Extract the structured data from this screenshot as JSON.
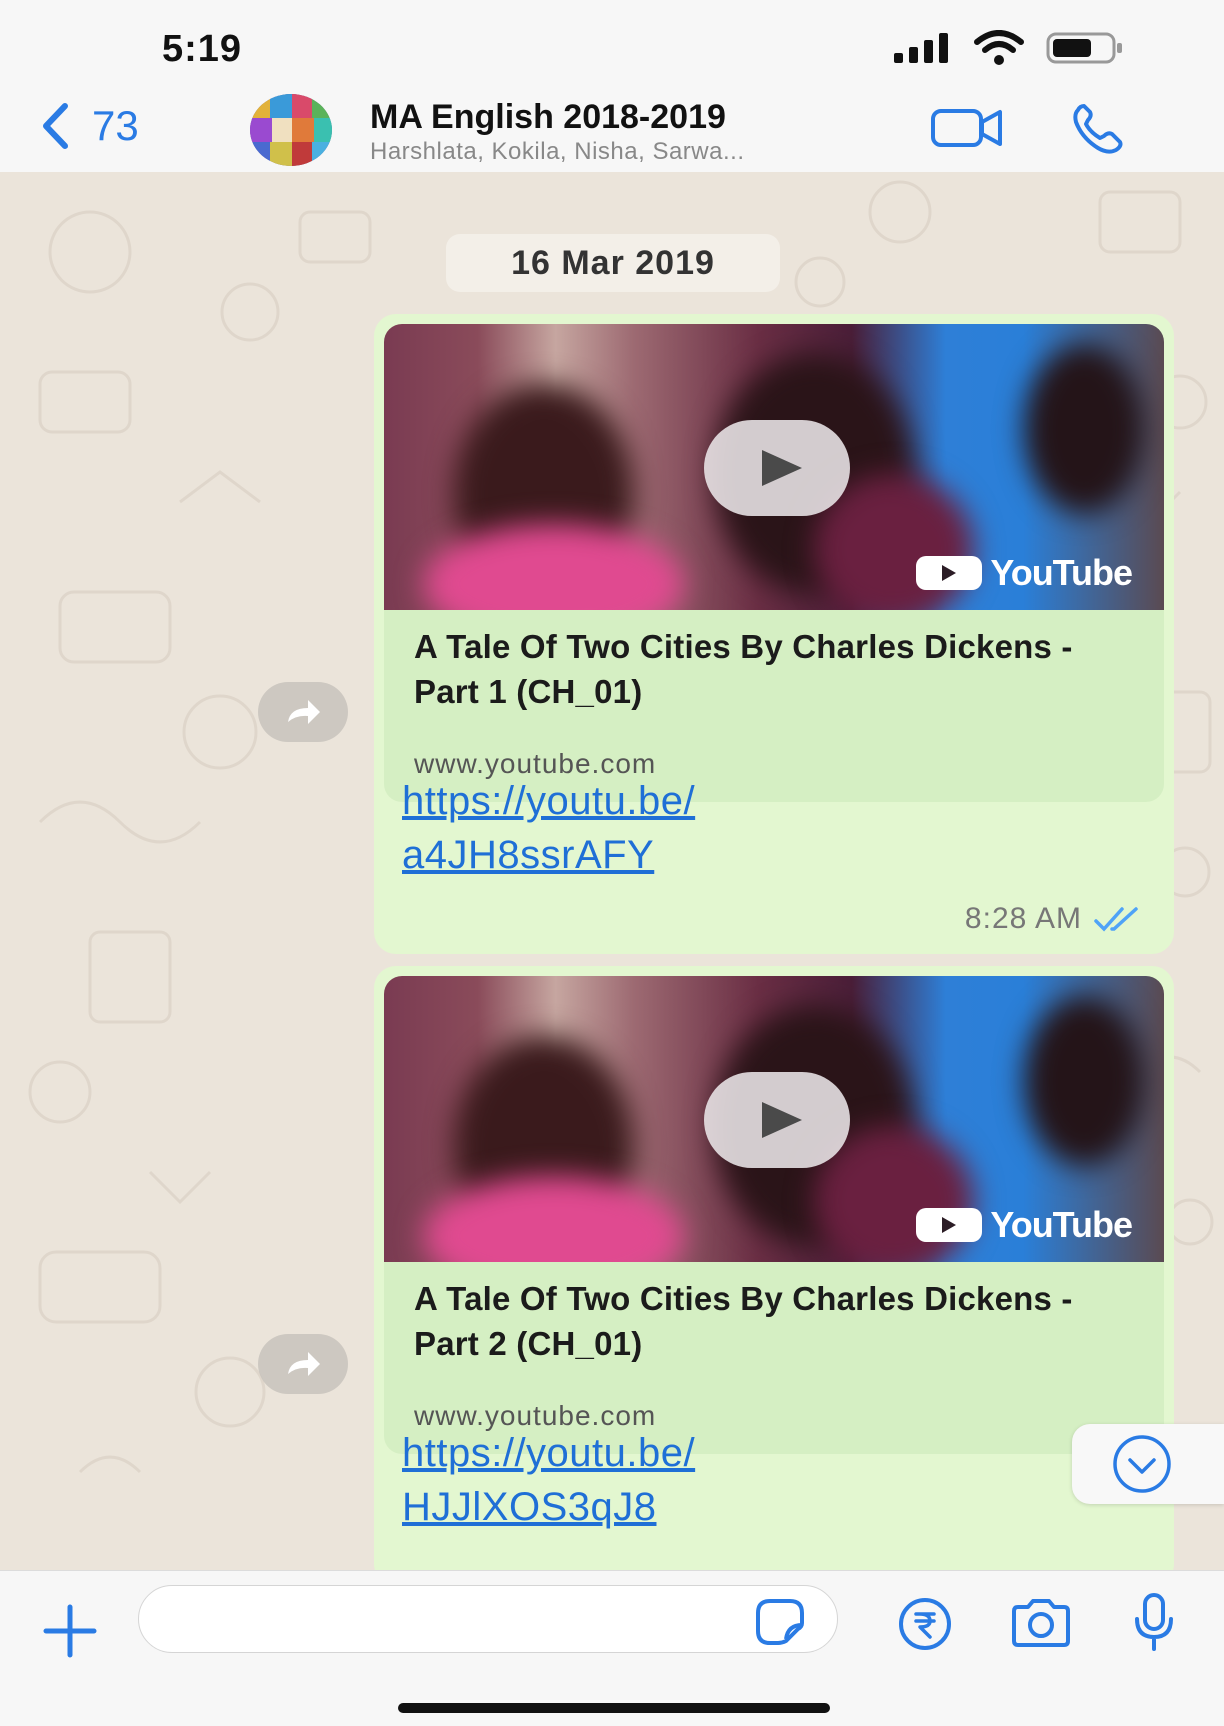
{
  "status_bar": {
    "time": "5:19",
    "icons": [
      "cellular-signal-icon",
      "wifi-icon",
      "battery-icon"
    ]
  },
  "header": {
    "back_count": "73",
    "group_name": "MA English 2018-2019",
    "participants": "Harshlata, Kokila, Nisha, Sarwa...",
    "icons": [
      "chevron-left-icon",
      "video-camera-icon",
      "phone-icon"
    ]
  },
  "chat": {
    "date_label": "16 Mar 2019",
    "messages": [
      {
        "preview_title": "A Tale Of Two Cities By Charles Dickens - Part 1 (CH_01)",
        "preview_domain": "www.youtube.com",
        "brand": "YouTube",
        "link_line1": "https://youtu.be/",
        "link_line2": "a4JH8ssrAFY",
        "time": "8:28 AM",
        "status": "read"
      },
      {
        "preview_title": "A Tale Of Two Cities By Charles Dickens - Part 2 (CH_01)",
        "preview_domain": "www.youtube.com",
        "brand": "YouTube",
        "link_line1": "https://youtu.be/",
        "link_line2": "HJJlXOS3qJ8"
      }
    ]
  },
  "input_bar": {
    "placeholder": "",
    "icons": [
      "plus-icon",
      "sticker-icon",
      "rupee-payment-icon",
      "camera-icon",
      "microphone-icon"
    ]
  },
  "colors": {
    "accent": "#2a7be4",
    "bubble_outgoing": "#e3f7d0",
    "preview_card": "#d5efc3",
    "chat_background": "#ebe4da",
    "read_ticks": "#4fa3f7"
  }
}
